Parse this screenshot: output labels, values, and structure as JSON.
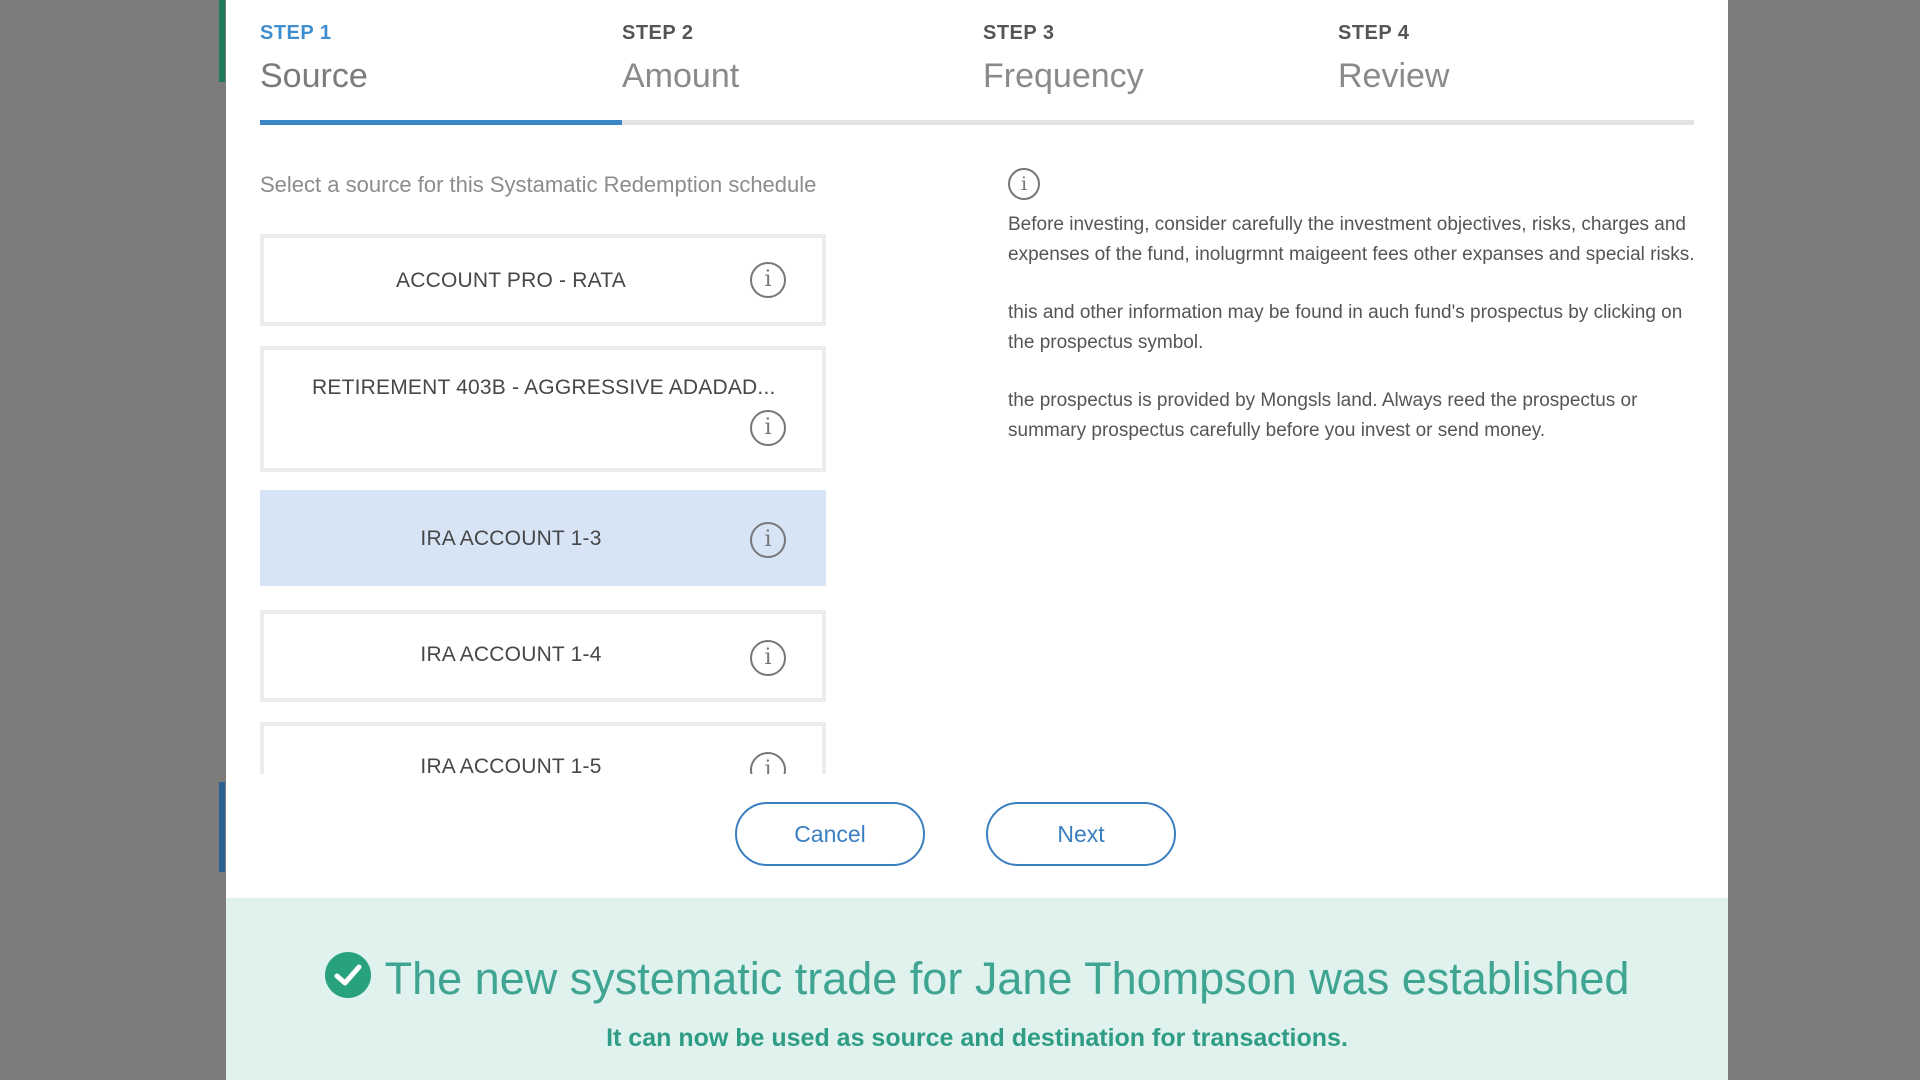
{
  "stepper": {
    "steps": [
      {
        "number": "STEP 1",
        "title": "Source"
      },
      {
        "number": "STEP 2",
        "title": "Amount"
      },
      {
        "number": "STEP 3",
        "title": "Frequency"
      },
      {
        "number": "STEP 4",
        "title": "Review"
      }
    ],
    "active_step": 1
  },
  "source": {
    "prompt": "Select a source for this Systamatic Redemption schedule",
    "items": [
      {
        "label": "ACCOUNT PRO - RATA",
        "info_icon": "info-icon"
      },
      {
        "label": "RETIREMENT 403B - AGGRESSIVE ADADAD...",
        "info_icon": "info-icon"
      },
      {
        "label": "IRA ACCOUNT 1-3",
        "info_icon": "info-icon",
        "selected": true
      },
      {
        "label": "IRA ACCOUNT 1-4",
        "info_icon": "info-icon"
      },
      {
        "label": "IRA ACCOUNT 1-5",
        "info_icon": "info-icon"
      }
    ],
    "info_glyph": "i"
  },
  "disclosure": {
    "icon": "i",
    "paragraphs": [
      "Before investing, consider carefully the investment objectives, risks, charges and expenses of the fund, inolugrmnt maigeent fees other expanses and special risks.",
      "this and other information may be found in auch fund's prospectus by clicking on the prospectus symbol.",
      "the prospectus is provided by Mongsls land. Always reed the prospectus or summary prospectus carefully before you invest or send money."
    ]
  },
  "actions": {
    "cancel_label": "Cancel",
    "next_label": "Next"
  },
  "banner": {
    "title": "The new systematic trade for Jane Thompson was established",
    "subtitle": "It can now be used as source and destination for transactions."
  },
  "colors": {
    "accent_blue": "#3b86c6",
    "selected_bg": "#d6e4f6",
    "success_green": "#28a17e",
    "banner_bg": "#dff2ee"
  }
}
